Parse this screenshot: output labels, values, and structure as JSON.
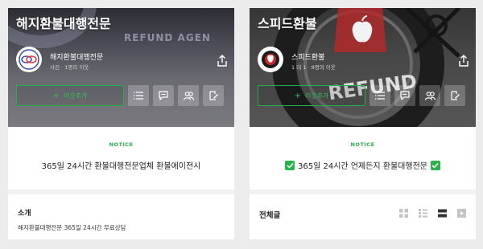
{
  "left_card": {
    "hero_title": "해지환불대행전문",
    "hero_deco_text": "REFUND AGEN",
    "profile_name": "해지환불대행전문",
    "profile_sub": "사진 · 1명의 이웃",
    "add_neighbor_label": "이웃추가",
    "notice_tag": "NOTICE",
    "notice_text": "365일 24시간 환불대행전문업체 환불에이전시",
    "intro_title": "소개",
    "intro_text": "해지환불대행전문 365일 24시간 무료상담"
  },
  "right_card": {
    "hero_title": "스피드환불",
    "hero_deco_text": "REFUND",
    "profile_name": "스피드환불",
    "profile_sub": "1 대 1 · 8명의 이웃",
    "add_neighbor_label": "이웃추가",
    "notice_tag": "NOTICE",
    "notice_text": "365일 24시간 언제든지 환불대행전문",
    "posts_label": "전체글"
  },
  "icons": {
    "share": "share-icon",
    "list": "list-icon",
    "chat": "chat-icon",
    "people": "people-icon",
    "write": "write-icon",
    "check": "check-mark-icon",
    "grid_view": "grid-view-icon",
    "list_view": "list-view-icon",
    "card_view": "card-view-icon",
    "video_view": "video-view-icon"
  },
  "colors": {
    "accent_green": "#27b24a",
    "background": "#ececec"
  }
}
